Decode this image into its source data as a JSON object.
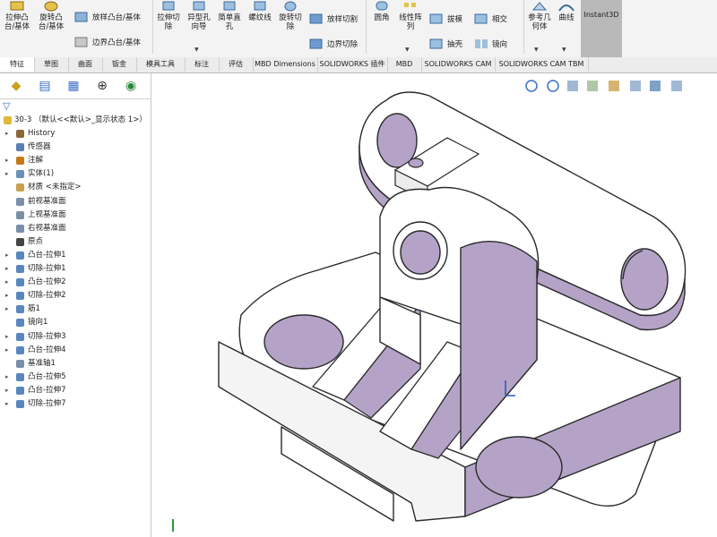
{
  "ribbon": {
    "buttons": [
      {
        "label": "拉伸凸\n台/基体"
      },
      {
        "label": "旋转凸\n台/基体"
      },
      {
        "label": "放样凸台/基体"
      },
      {
        "label": "边界凸台/基体"
      },
      {
        "label": "拉伸切\n除"
      },
      {
        "label": "异型孔\n向导"
      },
      {
        "label": "简单直\n孔"
      },
      {
        "label": "螺纹线"
      },
      {
        "label": "旋转切\n除"
      },
      {
        "label": "放样切割"
      },
      {
        "label": "边界切除"
      },
      {
        "label": "圆角"
      },
      {
        "label": "线性阵\n列"
      },
      {
        "label": "拔模"
      },
      {
        "label": "抽壳"
      },
      {
        "label": "相交"
      },
      {
        "label": "镜向"
      },
      {
        "label": "参考几\n何体"
      },
      {
        "label": "曲线"
      },
      {
        "label": "Instant3D"
      }
    ]
  },
  "tabs": [
    "特征",
    "草图",
    "曲面",
    "钣金",
    "模具工具",
    "标注",
    "评估",
    "MBD Dimensions",
    "SOLIDWORKS 插件",
    "MBD",
    "SOLIDWORKS CAM",
    "SOLIDWORKS CAM TBM"
  ],
  "tree": {
    "root": "30-3 （默认<<默认>_显示状态 1>）",
    "items": [
      {
        "label": "History",
        "arrow": "▸",
        "color": "#8a6a3a"
      },
      {
        "label": "传感器",
        "arrow": "",
        "color": "#5b7fb5"
      },
      {
        "label": "注解",
        "arrow": "▸",
        "color": "#c47a1a"
      },
      {
        "label": "实体(1)",
        "arrow": "▸",
        "color": "#6b8fb8"
      },
      {
        "label": "材质 <未指定>",
        "arrow": "",
        "color": "#c8a050"
      },
      {
        "label": "前视基准面",
        "arrow": "",
        "color": "#7a8fa8"
      },
      {
        "label": "上视基准面",
        "arrow": "",
        "color": "#7a8fa8"
      },
      {
        "label": "右视基准面",
        "arrow": "",
        "color": "#7a8fa8"
      },
      {
        "label": "原点",
        "arrow": "",
        "color": "#444444"
      },
      {
        "label": "凸台-拉伸1",
        "arrow": "▸",
        "color": "#5a86c0"
      },
      {
        "label": "切除-拉伸1",
        "arrow": "▸",
        "color": "#5a86c0"
      },
      {
        "label": "凸台-拉伸2",
        "arrow": "▸",
        "color": "#5a86c0"
      },
      {
        "label": "切除-拉伸2",
        "arrow": "▸",
        "color": "#5a86c0"
      },
      {
        "label": "筋1",
        "arrow": "▸",
        "color": "#5a86c0"
      },
      {
        "label": "镜向1",
        "arrow": "",
        "color": "#5a86c0"
      },
      {
        "label": "切除-拉伸3",
        "arrow": "▸",
        "color": "#5a86c0"
      },
      {
        "label": "凸台-拉伸4",
        "arrow": "▸",
        "color": "#5a86c0"
      },
      {
        "label": "基准轴1",
        "arrow": "",
        "color": "#7a8fa8"
      },
      {
        "label": "凸台-拉伸5",
        "arrow": "▸",
        "color": "#5a86c0"
      },
      {
        "label": "凸台-拉伸7",
        "arrow": "▸",
        "color": "#5a86c0"
      },
      {
        "label": "切除-拉伸7",
        "arrow": "▸",
        "color": "#5a86c0"
      }
    ]
  },
  "colors": {
    "part_face": "#ffffff",
    "part_shade": "#b5a3c7",
    "edge": "#2a2a2a"
  }
}
